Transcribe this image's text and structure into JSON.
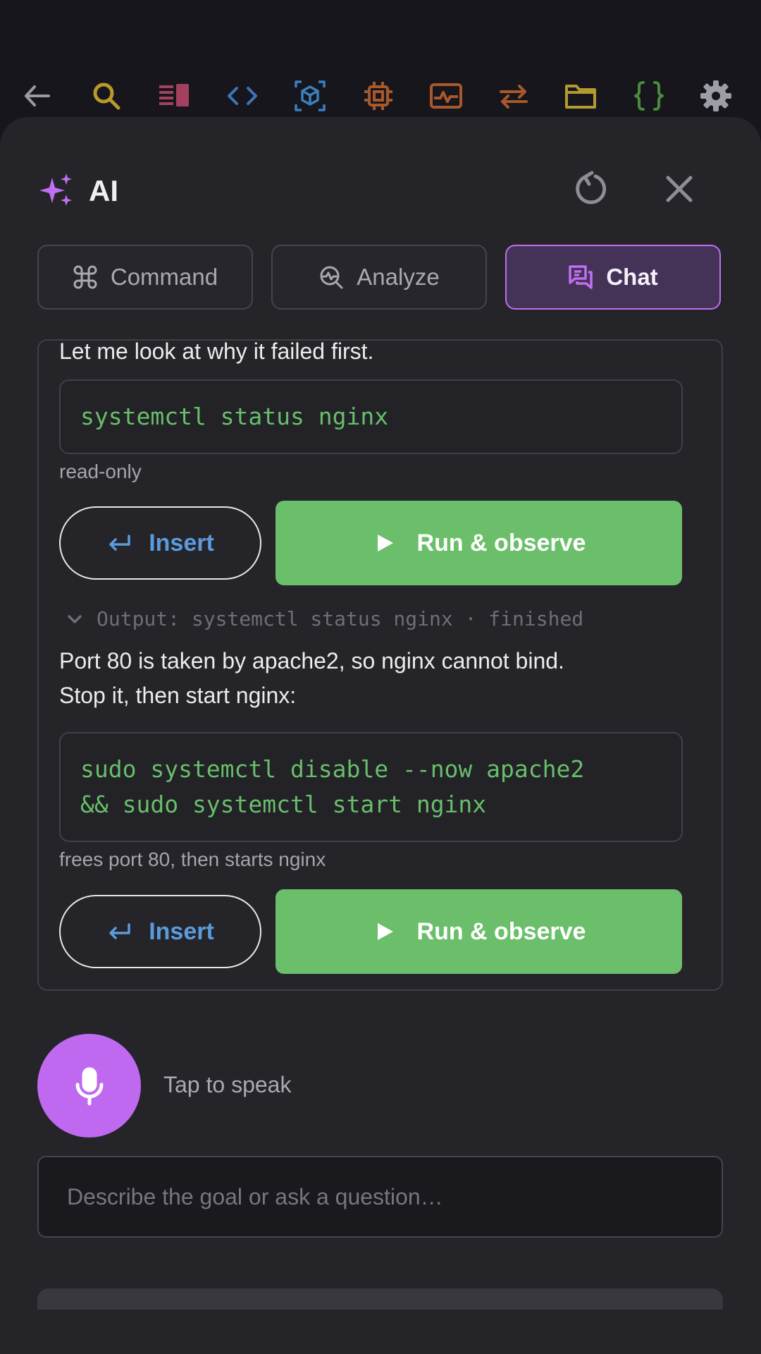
{
  "toolbar": {
    "icons": [
      "back-arrow-icon",
      "search-icon",
      "panel-icon",
      "code-icon",
      "cube-icon",
      "chip-icon",
      "pulse-icon",
      "swap-arrows-icon",
      "folder-icon",
      "braces-icon",
      "gear-icon"
    ]
  },
  "header": {
    "title": "AI"
  },
  "tabs": [
    {
      "label": "Command",
      "active": false
    },
    {
      "label": "Analyze",
      "active": false
    },
    {
      "label": "Chat",
      "active": true
    }
  ],
  "chat": {
    "intro_text": "Let me look at why it failed first.",
    "step1": {
      "command": "systemctl status nginx",
      "note": "read-only",
      "insert_label": "Insert",
      "run_label": "Run & observe"
    },
    "output_label": "Output: systemctl status nginx · finished",
    "message_line1": "Port 80 is taken by apache2, so nginx cannot bind.",
    "message_line2": "Stop it, then start nginx:",
    "step2": {
      "command_line1": "sudo systemctl disable --now apache2",
      "command_line2": "&& sudo systemctl start nginx",
      "note": "frees port 80, then starts nginx",
      "insert_label": "Insert",
      "run_label": "Run & observe"
    }
  },
  "voice": {
    "label": "Tap to speak"
  },
  "input": {
    "placeholder": "Describe the goal or ask a question…",
    "value": ""
  },
  "colors": {
    "accent_purple": "#bf6ff0",
    "run_green": "#6bbf6b",
    "code_green": "#68be6a",
    "insert_blue": "#5b9bdc"
  }
}
